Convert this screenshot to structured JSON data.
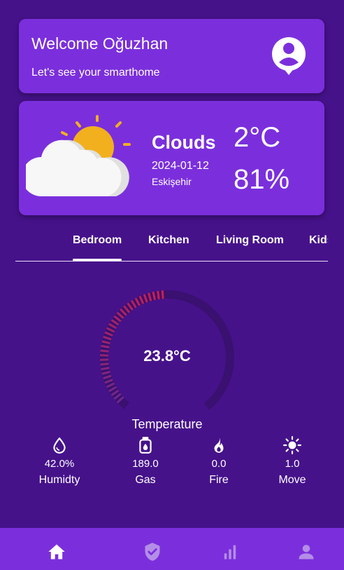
{
  "welcome": {
    "title": "Welcome Oğuzhan",
    "subtitle": "Let's see your smarthome",
    "icon": "account-circle-icon"
  },
  "weather": {
    "condition": "Clouds",
    "date": "2024-01-12",
    "city": "Eskişehir",
    "temperature": "2°C",
    "humidity": "81%",
    "icon": "partly-cloudy-icon"
  },
  "tabs": [
    {
      "label": "Bedroom",
      "selected": true
    },
    {
      "label": "Kitchen",
      "selected": false
    },
    {
      "label": "Living Room",
      "selected": false
    },
    {
      "label": "Kids",
      "selected": false
    }
  ],
  "gauge": {
    "value": "23.8°C",
    "label": "Temperature"
  },
  "sensors": [
    {
      "value": "42.0%",
      "label": "Humidty",
      "icon": "water-drop-icon"
    },
    {
      "value": "189.0",
      "label": "Gas",
      "icon": "gas-cylinder-icon"
    },
    {
      "value": "0.0",
      "label": "Fire",
      "icon": "fire-icon"
    },
    {
      "value": "1.0",
      "label": "Move",
      "icon": "sun-icon"
    }
  ],
  "bottom_nav": [
    {
      "icon": "home-icon",
      "active": true
    },
    {
      "icon": "shield-check-icon",
      "active": false
    },
    {
      "icon": "bar-chart-icon",
      "active": false
    },
    {
      "icon": "person-icon",
      "active": false
    }
  ],
  "colors": {
    "background": "#46128a",
    "card": "#7b2fdc",
    "gauge_start": "#c2185b",
    "gauge_track": "#3a1070"
  }
}
